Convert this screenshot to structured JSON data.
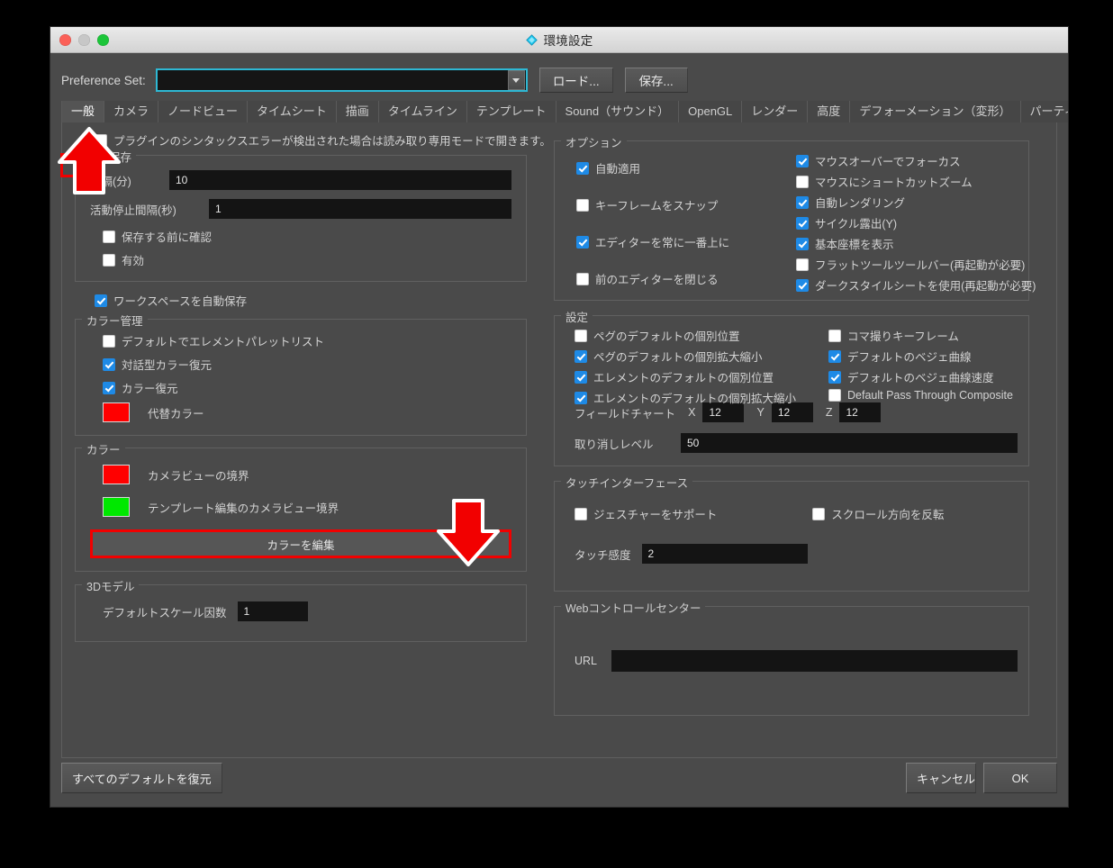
{
  "window": {
    "title": "環境設定",
    "title_icon": "diamond-icon",
    "accent_cyan": "#2eb8d4",
    "annotation_red": "#f20000",
    "traffic_lights": [
      "close",
      "minimize",
      "maximize"
    ]
  },
  "toolbar": {
    "pref_set_label": "Preference Set:",
    "pref_set_value": "",
    "pref_set_placeholder": "",
    "load_label": "ロード...",
    "save_label": "保存..."
  },
  "tabs": [
    {
      "label": "一般",
      "active": true
    },
    {
      "label": "カメラ",
      "active": false
    },
    {
      "label": "ノードビュー",
      "active": false
    },
    {
      "label": "タイムシート",
      "active": false
    },
    {
      "label": "描画",
      "active": false
    },
    {
      "label": "タイムライン",
      "active": false
    },
    {
      "label": "テンプレート",
      "active": false
    },
    {
      "label": "Sound（サウンド）",
      "active": false
    },
    {
      "label": "OpenGL",
      "active": false
    },
    {
      "label": "レンダー",
      "active": false
    },
    {
      "label": "高度",
      "active": false
    },
    {
      "label": "デフォーメーション（変形）",
      "active": false
    },
    {
      "label": "パーティクル",
      "active": false
    }
  ],
  "left": {
    "plugin_syntax_checkbox": {
      "label": "プラグインのシンタックスエラーが検出された場合は読み取り専用モードで開きます。",
      "checked": false
    },
    "autosave": {
      "title": "自動保存",
      "interval_label": "間隔(分)",
      "interval_value": "10",
      "inactivity_label": "活動停止間隔(秒)",
      "inactivity_value": "1",
      "checkboxes": [
        {
          "label": "保存する前に確認",
          "checked": false
        },
        {
          "label": "有効",
          "checked": false
        }
      ]
    },
    "workspace_autosave": {
      "label": "ワークスペースを自動保存",
      "checked": true
    },
    "color_management": {
      "title": "カラー管理",
      "checkboxes": [
        {
          "label": "デフォルトでエレメントパレットリスト",
          "checked": false
        },
        {
          "label": "対話型カラー復元",
          "checked": true
        },
        {
          "label": "カラー復元",
          "checked": true
        }
      ],
      "swatch": {
        "label": "代替カラー",
        "color": "#ff0000"
      }
    },
    "color": {
      "title": "カラー",
      "swatches": [
        {
          "label": "カメラビューの境界",
          "color": "#ff0000"
        },
        {
          "label": "テンプレート編集のカメラビュー境界",
          "color": "#00e800"
        }
      ],
      "edit_button": "カラーを編集"
    },
    "model3d": {
      "title": "3Dモデル",
      "scale_label": "デフォルトスケール因数",
      "scale_value": "1"
    }
  },
  "right": {
    "options": {
      "title": "オプション",
      "left_checkboxes": [
        {
          "label": "自動適用",
          "checked": true
        },
        {
          "label": "キーフレームをスナップ",
          "checked": false
        },
        {
          "label": "エディターを常に一番上に",
          "checked": true
        },
        {
          "label": "前のエディターを閉じる",
          "checked": false
        }
      ],
      "right_checkboxes": [
        {
          "label": "マウスオーバーでフォーカス",
          "checked": true
        },
        {
          "label": "マウスにショートカットズーム",
          "checked": false
        },
        {
          "label": "自動レンダリング",
          "checked": true
        },
        {
          "label": "サイクル露出(Y)",
          "checked": true
        },
        {
          "label": "基本座標を表示",
          "checked": true
        },
        {
          "label": "フラットツールツールバー(再起動が必要)",
          "checked": false
        },
        {
          "label": "ダークスタイルシートを使用(再起動が必要)",
          "checked": true
        }
      ]
    },
    "settings": {
      "title": "設定",
      "left_checkboxes": [
        {
          "label": "ペグのデフォルトの個別位置",
          "checked": false
        },
        {
          "label": "ペグのデフォルトの個別拡大縮小",
          "checked": true
        },
        {
          "label": "エレメントのデフォルトの個別位置",
          "checked": true
        },
        {
          "label": "エレメントのデフォルトの個別拡大縮小",
          "checked": true
        }
      ],
      "right_checkboxes": [
        {
          "label": "コマ撮りキーフレーム",
          "checked": false
        },
        {
          "label": "デフォルトのベジェ曲線",
          "checked": true
        },
        {
          "label": "デフォルトのベジェ曲線速度",
          "checked": true
        },
        {
          "label": "Default Pass Through Composite",
          "checked": false
        }
      ],
      "fieldchart_label": "フィールドチャート",
      "fieldchart_x_label": "X",
      "fieldchart_x_value": "12",
      "fieldchart_y_label": "Y",
      "fieldchart_y_value": "12",
      "fieldchart_z_label": "Z",
      "fieldchart_z_value": "12",
      "undo_label": "取り消しレベル",
      "undo_value": "50"
    },
    "touch": {
      "title": "タッチインターフェース",
      "checkboxes": [
        {
          "label": "ジェスチャーをサポート",
          "checked": false
        },
        {
          "label": "スクロール方向を反転",
          "checked": false
        }
      ],
      "sensitivity_label": "タッチ感度",
      "sensitivity_value": "2"
    },
    "web": {
      "title": "Webコントロールセンター",
      "url_label": "URL",
      "url_value": ""
    }
  },
  "footer": {
    "restore_label": "すべてのデフォルトを復元",
    "cancel_label": "キャンセル",
    "ok_label": "OK"
  },
  "annotations": [
    {
      "type": "highlight-box",
      "target": "tab-一般"
    },
    {
      "type": "arrow-up",
      "target": "tab-一般"
    },
    {
      "type": "arrow-down",
      "target": "edit-colors-button"
    },
    {
      "type": "highlight-box",
      "target": "edit-colors-button"
    }
  ]
}
